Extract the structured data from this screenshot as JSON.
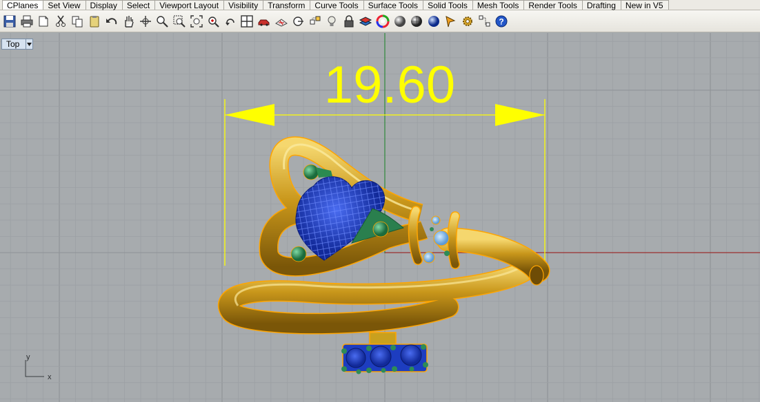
{
  "tabs": [
    {
      "label": "CPlanes",
      "active": true
    },
    {
      "label": "Set View"
    },
    {
      "label": "Display"
    },
    {
      "label": "Select"
    },
    {
      "label": "Viewport Layout"
    },
    {
      "label": "Visibility"
    },
    {
      "label": "Transform"
    },
    {
      "label": "Curve Tools"
    },
    {
      "label": "Surface Tools"
    },
    {
      "label": "Solid Tools"
    },
    {
      "label": "Mesh Tools"
    },
    {
      "label": "Render Tools"
    },
    {
      "label": "Drafting"
    },
    {
      "label": "New in V5"
    }
  ],
  "toolbar": {
    "icons": [
      "save-icon",
      "print-icon",
      "import-icon",
      "cut-icon",
      "copy-icon",
      "paste-icon",
      "undo-icon",
      "pan-hand-icon",
      "rotate-view-icon",
      "zoom-icon",
      "zoom-window-icon",
      "zoom-extents-icon",
      "zoom-selected-icon",
      "undo-view-icon",
      "four-viewports-icon",
      "named-view-car-icon",
      "cplane-icon",
      "object-snap-icon",
      "osnap-settings-icon",
      "light-bulb-icon",
      "lock-icon",
      "layer-icon",
      "color-wheel-icon",
      "shaded-sphere-icon",
      "rendered-sphere-icon",
      "blue-sphere-icon",
      "lasso-select-icon",
      "gear-settings-icon",
      "grid-snap-icon",
      "help-icon"
    ]
  },
  "viewport": {
    "name": "Top",
    "dimension_value": "19.60",
    "axis_x_label": "x",
    "axis_y_label": "y"
  },
  "colors": {
    "viewport_bg": "#a7abae",
    "grid_minor": "#9ca0a4",
    "grid_major": "#8e9296",
    "dimension": "#ffff00",
    "selection_outline": "#ffa500",
    "gold": "#d4a91c",
    "sapphire": "#2540b8",
    "prong_green": "#2e8b57"
  }
}
